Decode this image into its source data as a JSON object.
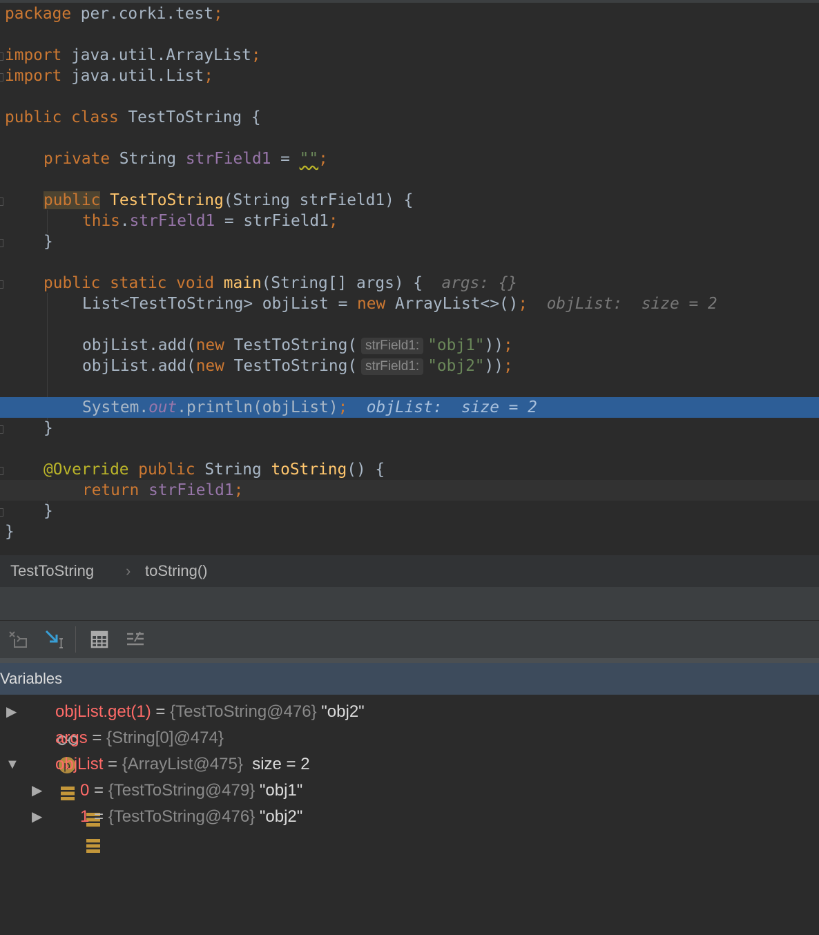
{
  "editor": {
    "lines": {
      "l1": {
        "kw": "package",
        "rest": " per.corki.test",
        "semi": ";"
      },
      "l3": {
        "kw": "import",
        "rest": " java.util.ArrayList",
        "semi": ";"
      },
      "l4": {
        "kw": "import",
        "rest": " java.util.List",
        "semi": ";"
      },
      "l6": {
        "kw1": "public",
        "kw2": "class",
        "name": "TestToString",
        "brace": " {"
      },
      "l8": {
        "kw": "private",
        "type": " String ",
        "field": "strField1",
        "eq": " = ",
        "str": "\"\"",
        "semi": ";"
      },
      "l10": {
        "kw": "public",
        "fn": "TestToString",
        "rest": "(String strField1) {"
      },
      "l11": {
        "kw": "this",
        "dot": ".",
        "field": "strField1",
        "rest": " = strField1",
        "semi": ";"
      },
      "l12": {
        "text": "}"
      },
      "l14": {
        "kw": "public static void",
        "fn": "main",
        "rest": "(String[] args) {",
        "hint": "args: {}"
      },
      "l15": {
        "code": "List<TestToString> objList = ",
        "kw": "new",
        "rest": " ArrayList<>()",
        "semi": ";",
        "hint1": "objList:",
        "hint2": "size = 2"
      },
      "l17": {
        "code": "objList.add(",
        "kw": "new",
        "rest": " TestToString(",
        "param": "strField1:",
        "str": "\"obj1\"",
        "close": "))",
        "semi": ";"
      },
      "l18": {
        "code": "objList.add(",
        "kw": "new",
        "rest": " TestToString(",
        "param": "strField1:",
        "str": "\"obj2\"",
        "close": "))",
        "semi": ";"
      },
      "l20": {
        "code": "System.",
        "st": "out",
        "rest": ".println(objList)",
        "semi": ";",
        "hint1": "objList:",
        "hint2": "size = 2"
      },
      "l21": {
        "text": "}"
      },
      "l23": {
        "anno": "@Override",
        "kw": "public",
        "type": " String ",
        "fn": "toString",
        "rest": "() {"
      },
      "l24": {
        "kw": "return",
        "field": "strField1",
        "semi": ";"
      },
      "l25": {
        "text": "}"
      },
      "l26": {
        "text": "}"
      }
    }
  },
  "breadcrumb": {
    "item1": "TestToString",
    "sep": "›",
    "item2": "toString()"
  },
  "toolbar": {
    "icons": [
      "restore-layout-icon",
      "step-into-icon",
      "evaluate-expression-icon",
      "trace-icon"
    ]
  },
  "variables": {
    "title": "Variables",
    "rows": [
      {
        "name": "objList.get(1)",
        "eq": " = ",
        "val": "{TestToString@476}",
        "str": " \"obj2\"",
        "icon": "watch-icon",
        "expanded": false
      },
      {
        "name": "args",
        "eq": " = ",
        "val": "{String[0]@474}",
        "str": "",
        "icon": "parameter-icon",
        "badge": "p"
      },
      {
        "name": "objList",
        "eq": " = ",
        "val": "{ArrayList@475}",
        "str": "  size = 2",
        "icon": "list-icon",
        "expanded": true
      },
      {
        "name": "0",
        "eq": " = ",
        "val": "{TestToString@479}",
        "str": " \"obj1\"",
        "icon": "list-icon",
        "expanded": false
      },
      {
        "name": "1",
        "eq": " = ",
        "val": "{TestToString@476}",
        "str": " \"obj2\"",
        "icon": "list-icon",
        "expanded": false
      }
    ]
  },
  "colors": {
    "background": "#2b2b2b",
    "keyword": "#cc7832",
    "string": "#6a8759",
    "field": "#9876aa",
    "method": "#ffc66d",
    "exec_line": "#2d5e97",
    "var_name": "#ff6b68"
  }
}
